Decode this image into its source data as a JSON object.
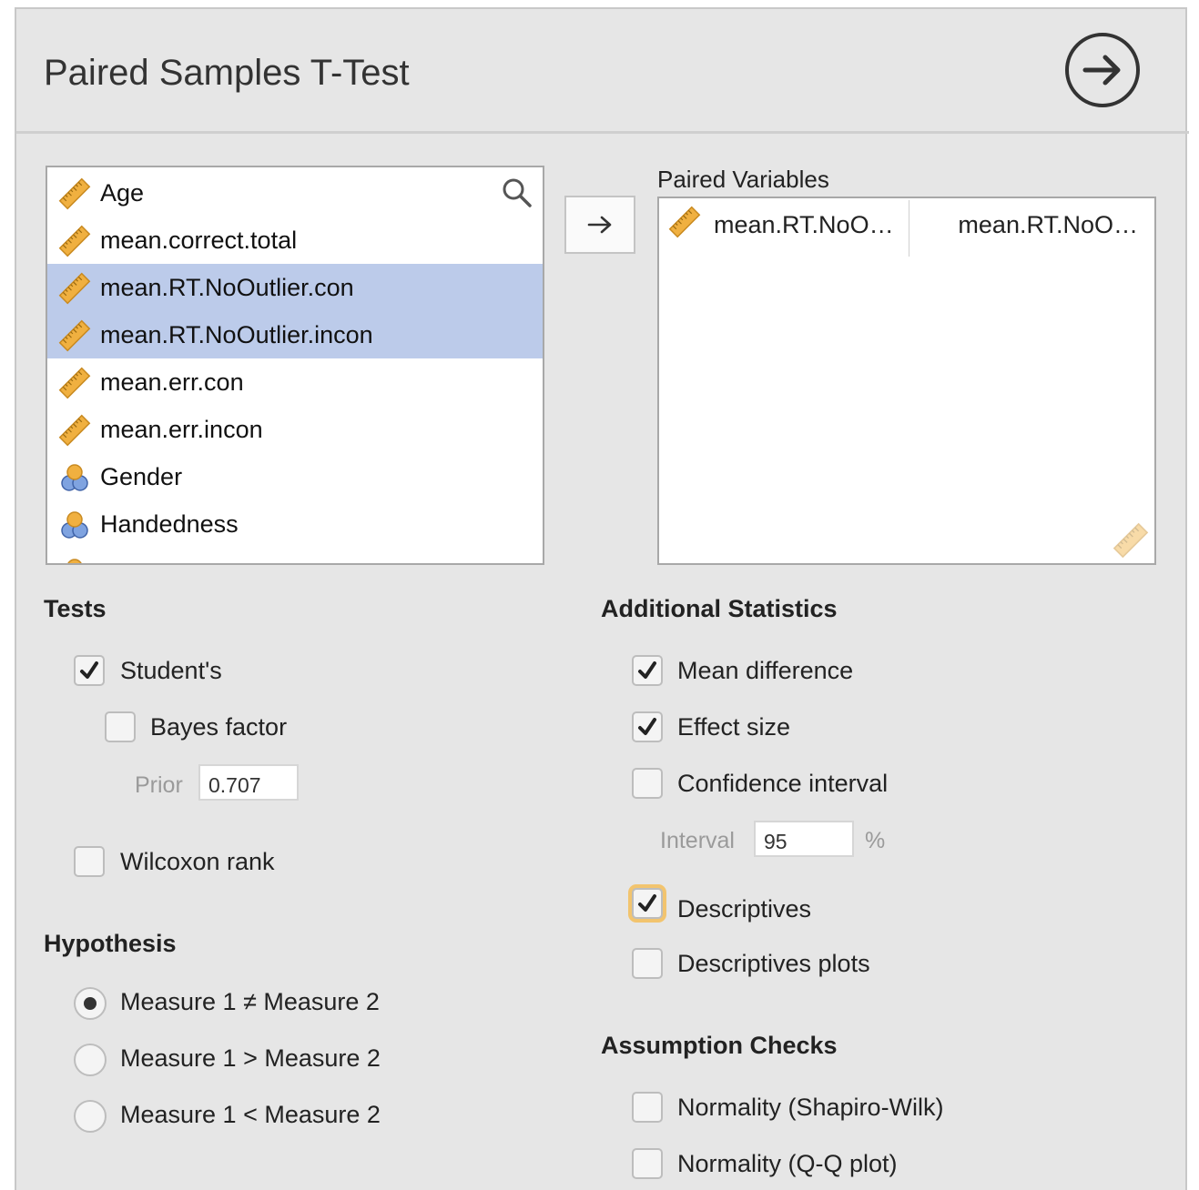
{
  "header": {
    "title": "Paired Samples T-Test"
  },
  "variables": [
    {
      "label": "Age",
      "type": "scale",
      "selected": false
    },
    {
      "label": "mean.correct.total",
      "type": "scale",
      "selected": false
    },
    {
      "label": "mean.RT.NoOutlier.con",
      "type": "scale",
      "selected": true
    },
    {
      "label": "mean.RT.NoOutlier.incon",
      "type": "scale",
      "selected": true
    },
    {
      "label": "mean.err.con",
      "type": "scale",
      "selected": false
    },
    {
      "label": "mean.err.incon",
      "type": "scale",
      "selected": false
    },
    {
      "label": "Gender",
      "type": "nominal",
      "selected": false
    },
    {
      "label": "Handedness",
      "type": "nominal",
      "selected": false
    }
  ],
  "paired": {
    "label": "Paired Variables",
    "pair_1": "mean.RT.NoO…",
    "pair_2": "mean.RT.NoO…"
  },
  "tests": {
    "heading": "Tests",
    "students": {
      "label": "Student's",
      "checked": true
    },
    "bayes": {
      "label": "Bayes factor",
      "checked": false
    },
    "prior_label": "Prior",
    "prior_value": "0.707",
    "wilcoxon": {
      "label": "Wilcoxon rank",
      "checked": false
    }
  },
  "hypothesis": {
    "heading": "Hypothesis",
    "options": [
      "Measure 1 ≠ Measure 2",
      "Measure 1 > Measure 2",
      "Measure 1 < Measure 2"
    ],
    "selected": 0
  },
  "additional": {
    "heading": "Additional Statistics",
    "mean_difference": {
      "label": "Mean difference",
      "checked": true
    },
    "effect_size": {
      "label": "Effect size",
      "checked": true
    },
    "confidence_interval": {
      "label": "Confidence interval",
      "checked": false
    },
    "interval_label": "Interval",
    "interval_value": "95",
    "interval_unit": "%",
    "descriptives": {
      "label": "Descriptives",
      "checked": true
    },
    "descriptives_plots": {
      "label": "Descriptives plots",
      "checked": false
    }
  },
  "assumptions": {
    "heading": "Assumption Checks",
    "shapiro": {
      "label": "Normality (Shapiro-Wilk)",
      "checked": false
    },
    "qq": {
      "label": "Normality (Q-Q plot)",
      "checked": false
    }
  },
  "colors": {
    "selection": "#bccbea",
    "scale_icon": "#f0b040",
    "focus_ring": "#f2c46e"
  },
  "icons": {
    "go": "arrow-right-circle-icon",
    "move": "arrow-right-icon",
    "search": "search-icon",
    "scale": "ruler-icon",
    "nominal": "nominal-circles-icon"
  }
}
